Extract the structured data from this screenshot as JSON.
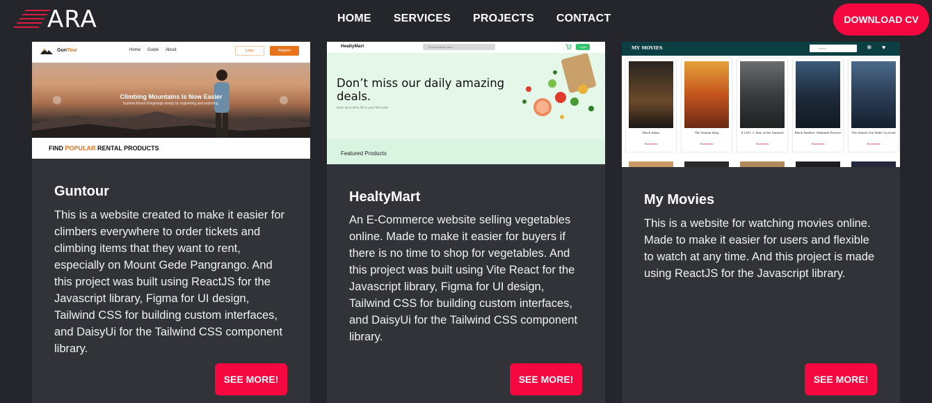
{
  "brand": {
    "logo_text": "ARA"
  },
  "nav": {
    "items": [
      "HOME",
      "SERVICES",
      "PROJECTS",
      "CONTACT"
    ]
  },
  "header": {
    "cta_label": "DOWNLOAD CV"
  },
  "colors": {
    "accent": "#f5073f",
    "background": "#24262b",
    "card": "#313338"
  },
  "projects": [
    {
      "title": "Guntour",
      "description": "This is a website created to make it easier for climbers everywhere to order tickets and climbing items that they want to rent, especially on Mount Gede Pangrango. And this project was built using ReactJS for the Javascript library, Figma for UI design, Tailwind CSS for building custom interfaces, and DaisyUi for the Tailwind CSS component library.",
      "button_label": "SEE MORE!",
      "preview": {
        "brand_a": "Gun",
        "brand_b": "Tour",
        "menu": [
          "Home",
          "Guide",
          "About"
        ],
        "login": "Login",
        "register": "Register",
        "hero_title": "Climbing Mountains Is Now Easier",
        "hero_sub": "Explore Mount Pangrango simply by registering and exploring.",
        "section_a": "FIND ",
        "section_b": "POPULAR",
        "section_c": " RENTAL PRODUCTS"
      }
    },
    {
      "title": "HealtyMart",
      "description": "An E-Commerce website selling vegetables online. Made to make it easier for buyers if there is no time to shop for vegetables. And this project was built using Vite React for the Javascript library, Figma for UI design, Tailwind CSS for building custom interfaces, and DaisyUi for the Tailwind CSS component library.",
      "button_label": "SEE MORE!",
      "preview": {
        "brand": "HealtyMart",
        "search_placeholder": "Find products here...",
        "login": "Login",
        "hero_title": "Don’t miss our daily amazing deals.",
        "hero_sub": "Save up to 60% off on your first order",
        "section": "Featured Products"
      }
    },
    {
      "title": "My Movies",
      "description": "This is a website for watching movies online. Made to make it easier for users and flexible to watch at any time. And this project is made using ReactJS for the Javascript library.",
      "button_label": "SEE MORE!",
      "preview": {
        "brand": "MY MOVIES",
        "search_placeholder": "Search",
        "fav_label": "Favorites",
        "movies": [
          {
            "name": "Black Adam",
            "color": "#5a3a22"
          },
          {
            "name": "The Woman King",
            "color": "#c4541d"
          },
          {
            "name": "R.I.P.D. 2: Rise of the Damned",
            "color": "#3a3d40"
          },
          {
            "name": "Black Panther: Wakanda Forever",
            "color": "#1f2c3d"
          },
          {
            "name": "The Minute You Wake Up Dead",
            "color": "#2d3e57"
          }
        ]
      }
    }
  ]
}
